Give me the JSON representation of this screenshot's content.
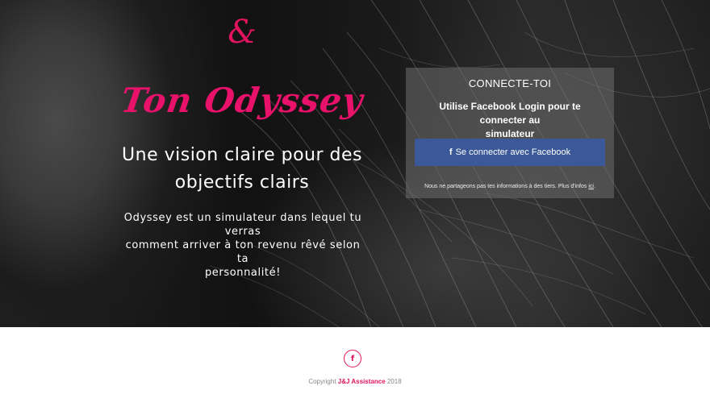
{
  "hero": {
    "ampersand": "&",
    "brand": "Ton Odyssey",
    "headline_line1": "Une vision claire pour des",
    "headline_line2": "objectifs clairs",
    "description_line1": "Odyssey est un simulateur dans lequel tu verras",
    "description_line2": "comment arriver à ton revenu rêvé selon ta",
    "description_line3": "personnalité!"
  },
  "login_card": {
    "title": "CONNECTE-TOI",
    "subtitle_line1": "Utilise Facebook Login pour te connecter au",
    "subtitle_line2": "simulateur",
    "button_icon": "facebook-icon",
    "button_glyph": "f",
    "button_label": "Se connecter avec Facebook",
    "privacy_text": "Nous ne partageons pas tes informations à des tiers. Plus d'infos",
    "privacy_link": "ici",
    "privacy_end": "."
  },
  "footer": {
    "social_icon": "facebook-icon",
    "social_glyph": "f",
    "copyright_prefix": "Copyright",
    "company": "J&J Assistance",
    "year": "2018"
  },
  "colors": {
    "brand_pink": "#e8126a",
    "facebook_blue": "#3b5998"
  }
}
